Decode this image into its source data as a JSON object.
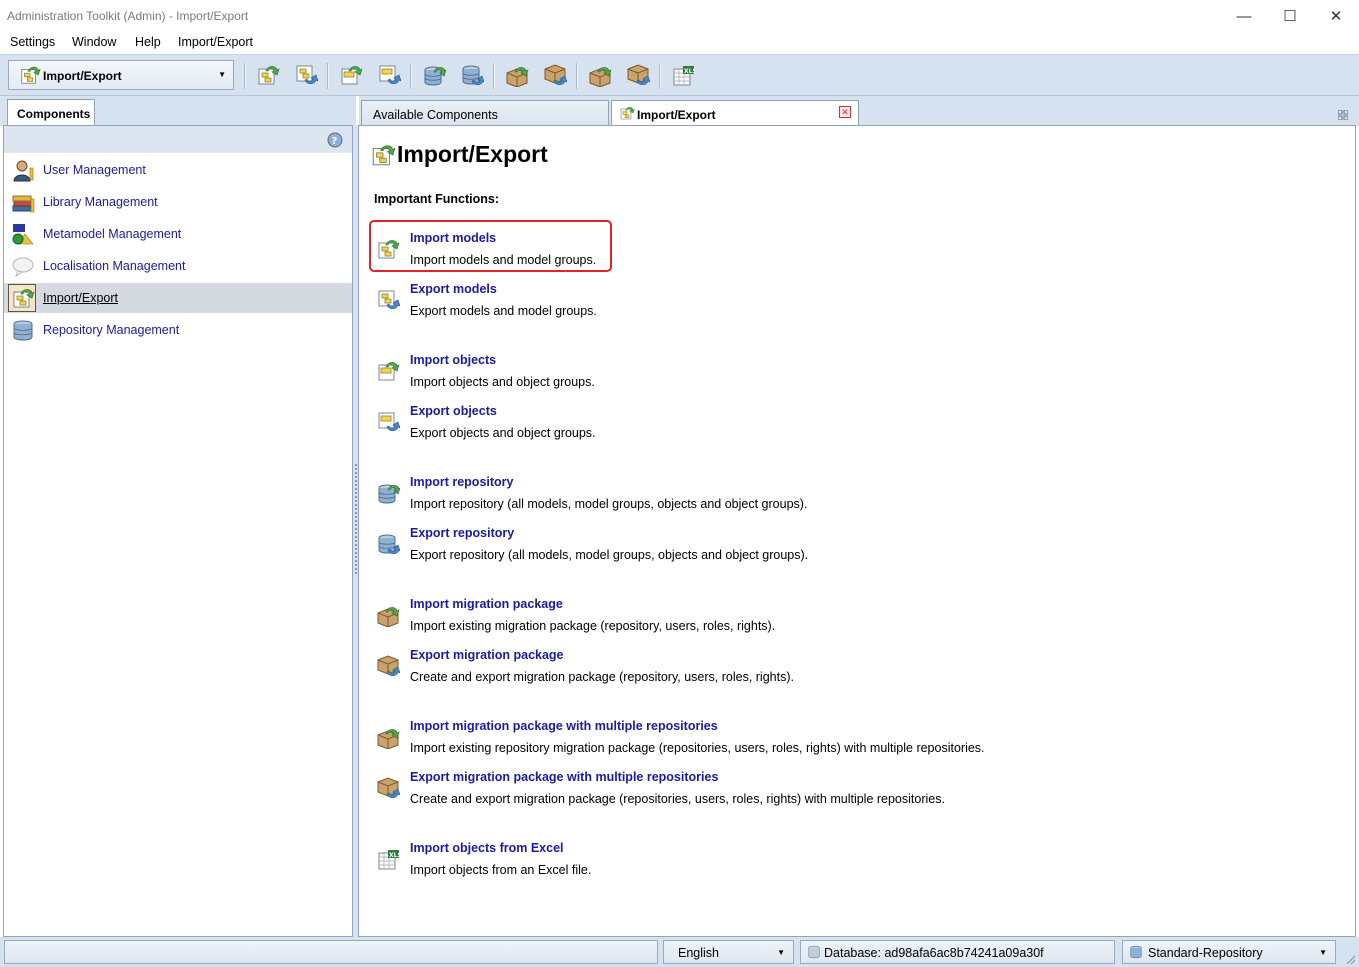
{
  "window": {
    "title": "Administration Toolkit (Admin) - Import/Export",
    "minimize": "—",
    "maximize": "☐",
    "close": "✕"
  },
  "menu": [
    "Settings",
    "Window",
    "Help",
    "Import/Export"
  ],
  "toolbar": {
    "combo_value": "Import/Export"
  },
  "left": {
    "tab": "Components",
    "items": [
      {
        "label": "User Management",
        "icon": "user-icon"
      },
      {
        "label": "Library Management",
        "icon": "library-icon"
      },
      {
        "label": "Metamodel Management",
        "icon": "metamodel-icon"
      },
      {
        "label": "Localisation Management",
        "icon": "localisation-icon"
      },
      {
        "label": "Import/Export",
        "icon": "import-export-icon",
        "selected": true
      },
      {
        "label": "Repository Management",
        "icon": "repository-icon"
      }
    ]
  },
  "right": {
    "tabs": [
      "Available Components",
      "Import/Export"
    ],
    "title": "Import/Export",
    "subtitle": "Important Functions:",
    "functions": [
      {
        "name": "Import models",
        "desc": "Import models and model groups."
      },
      {
        "name": "Export models",
        "desc": "Export models and model groups."
      },
      {
        "name": "Import objects",
        "desc": "Import objects and object groups."
      },
      {
        "name": "Export objects",
        "desc": "Export objects and object groups."
      },
      {
        "name": "Import repository",
        "desc": "Import repository (all models, model groups, objects and object groups)."
      },
      {
        "name": "Export repository",
        "desc": "Export repository (all models, model groups, objects and object groups)."
      },
      {
        "name": "Import migration package",
        "desc": "Import existing migration package (repository, users, roles, rights)."
      },
      {
        "name": "Export migration package",
        "desc": "Create and export migration package (repository, users, roles, rights)."
      },
      {
        "name": "Import migration package with multiple repositories",
        "desc": "Import existing repository migration package (repositories, users, roles, rights) with multiple repositories."
      },
      {
        "name": "Export migration package with multiple repositories",
        "desc": "Create and export migration package (repositories, users, roles, rights) with multiple repositories."
      },
      {
        "name": "Import objects from Excel",
        "desc": "Import objects from an Excel file."
      }
    ]
  },
  "status": {
    "language": "English",
    "database": "Database: ad98afa6ac8b74241a09a30f",
    "repository": "Standard-Repository"
  },
  "colors": {
    "link": "#1a1aa6",
    "chrome": "#d6e2ef",
    "highlight": "#e0242b"
  }
}
